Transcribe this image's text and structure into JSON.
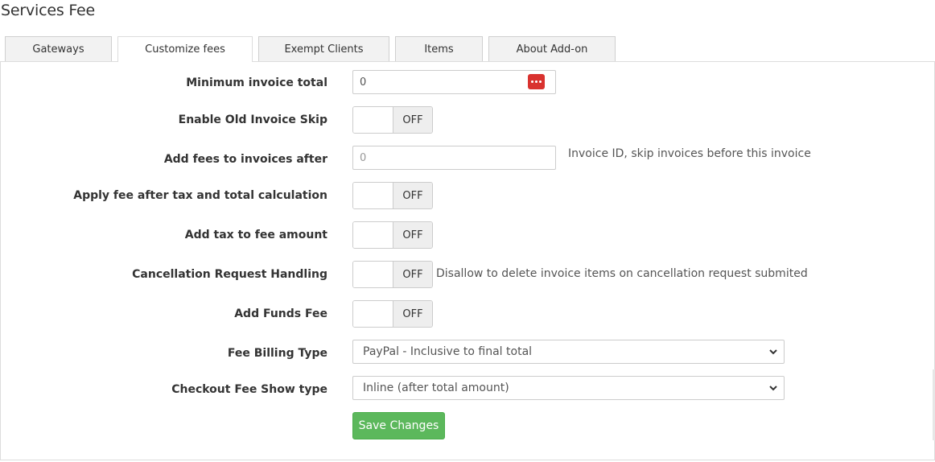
{
  "page": {
    "title": "Services Fee"
  },
  "tabs": [
    {
      "label": "Gateways",
      "active": false
    },
    {
      "label": "Customize fees",
      "active": true
    },
    {
      "label": "Exempt Clients",
      "active": false
    },
    {
      "label": "Items",
      "active": false
    },
    {
      "label": "About Add-on",
      "active": false
    }
  ],
  "form": {
    "min_invoice_total": {
      "label": "Minimum invoice total",
      "value": "0",
      "icon": "password-manager-icon"
    },
    "old_invoice_skip": {
      "label": "Enable Old Invoice Skip",
      "state": "OFF"
    },
    "fees_after": {
      "label": "Add fees to invoices after",
      "placeholder": "0",
      "help": "Invoice ID, skip invoices before this invoice"
    },
    "fee_after_tax": {
      "label": "Apply fee after tax and total calculation",
      "state": "OFF"
    },
    "tax_to_fee": {
      "label": "Add tax to fee amount",
      "state": "OFF"
    },
    "cancellation": {
      "label": "Cancellation Request Handling",
      "state": "OFF",
      "help": "Disallow to delete invoice items on cancellation request submited"
    },
    "funds_fee": {
      "label": "Add Funds Fee",
      "state": "OFF"
    },
    "billing_type": {
      "label": "Fee Billing Type",
      "selected": "PayPal - Inclusive to final total"
    },
    "checkout_show": {
      "label": "Checkout Fee Show type",
      "selected": "Inline (after total amount)"
    },
    "save_label": "Save Changes"
  },
  "colors": {
    "save_button": "#5cb85c",
    "toggle_off": "#eeeeee",
    "password_icon": "#d9322f"
  }
}
